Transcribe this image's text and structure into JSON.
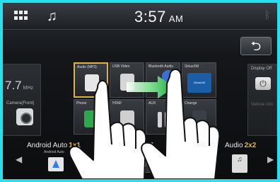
{
  "status_bar": {
    "time": "3:57",
    "ampm": "AM",
    "music_icon": "music-note-icon",
    "menu_icon": "grid-menu-icon",
    "bluetooth_icon": "bluetooth-icon"
  },
  "back_button": {
    "icon": "back-arrow-icon",
    "glyph": "⮌"
  },
  "left_panel": {
    "frequency": "7.7",
    "unit": "MHz",
    "camera_label": "Camera(Front)"
  },
  "right_panel": {
    "display_off_label": "Display Off",
    "power_glyph": "⏻",
    "second_label": "Vehicle Info"
  },
  "tiles": [
    {
      "id": "usb",
      "label": "Audio (MP3)"
    },
    {
      "id": "video",
      "label": "USB Video"
    },
    {
      "id": "bt",
      "label": "Bluetooth Audio"
    },
    {
      "id": "sxm",
      "label": "SiriusXM",
      "logo_text": "SiriusXM"
    },
    {
      "id": "phone",
      "label": "Phone"
    },
    {
      "id": "hdmi",
      "label": "HDMI"
    },
    {
      "id": "aux",
      "label": "AUX"
    },
    {
      "id": "ch",
      "label": "Change"
    }
  ],
  "bottom": {
    "android_auto": "Android Auto",
    "android_auto_mult": "1x1",
    "android_auto_mini": "Android Auto",
    "middle_prefix": "dio",
    "middle_mult": "1x1",
    "audio": "Audio",
    "audio_mult": "2x2",
    "music_glyph": "♫",
    "audio_glyph": "♫",
    "left_arrow": "◀",
    "right_arrow": "▶"
  },
  "colors": {
    "frame": "#27e0ee",
    "selected_border": "#d9b44a",
    "swipe_arrow": "#2fb55a",
    "multiplier": "#e3b53a"
  }
}
